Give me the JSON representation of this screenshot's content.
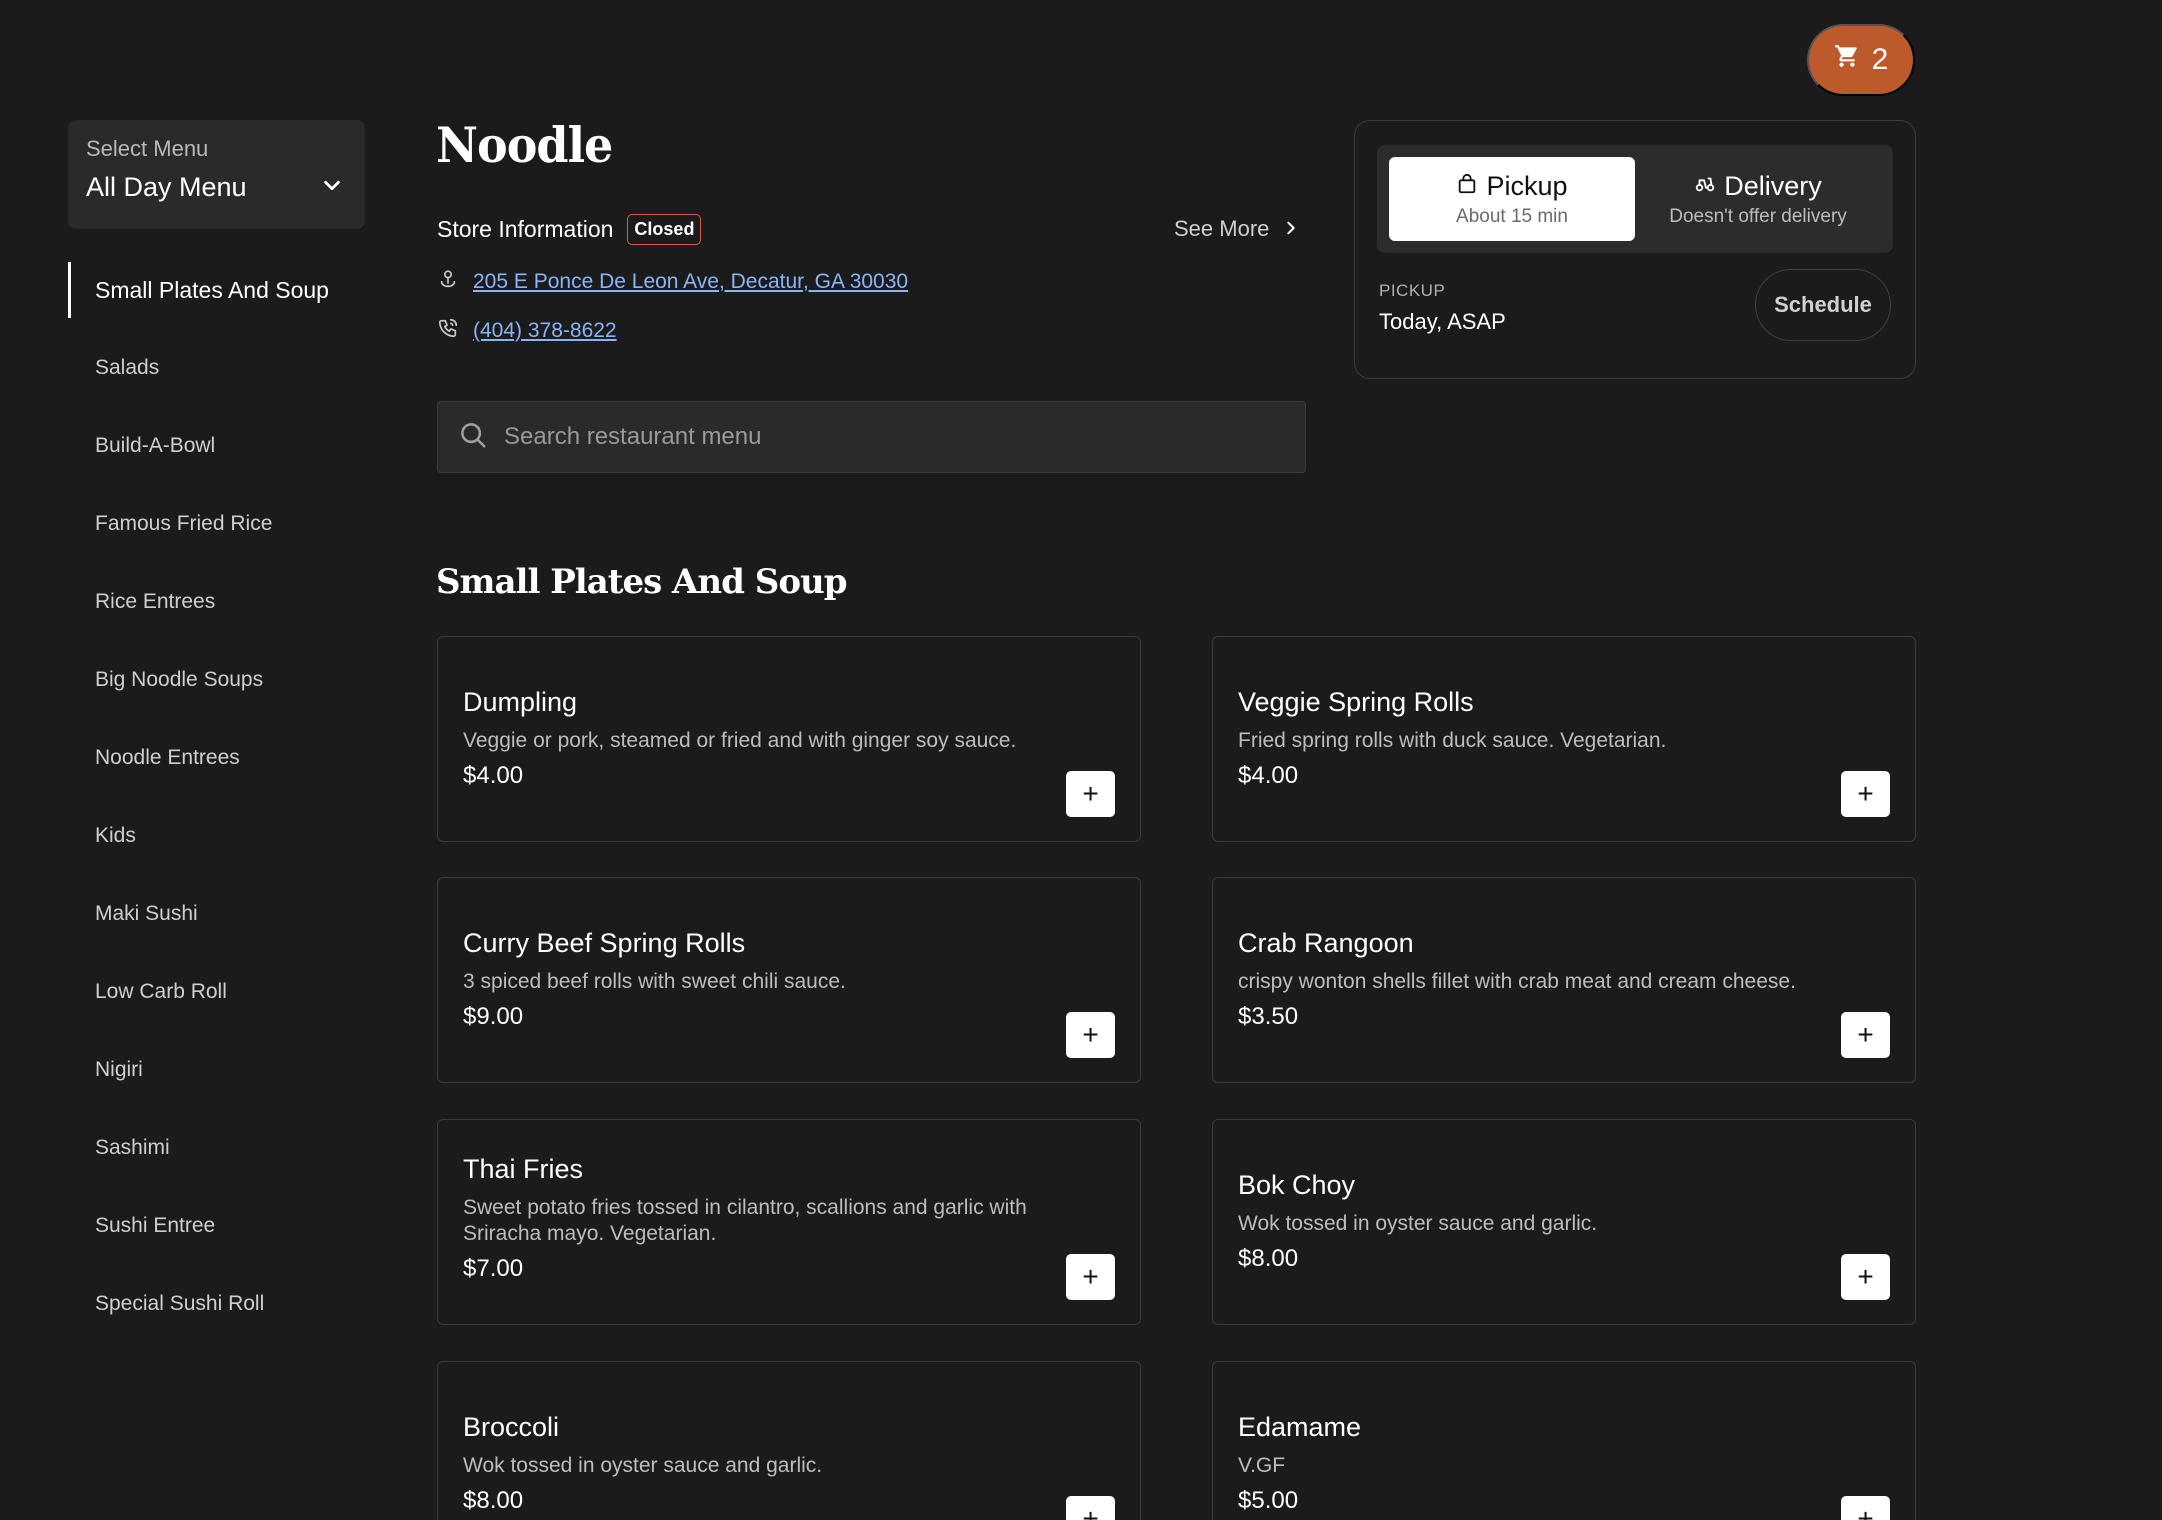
{
  "cart": {
    "count": "2",
    "icon": "cart-icon"
  },
  "menu_select": {
    "label": "Select Menu",
    "value": "All Day Menu"
  },
  "categories": [
    "Small Plates And Soup",
    "Salads",
    "Build-A-Bowl",
    "Famous Fried Rice",
    "Rice Entrees",
    "Big Noodle Soups",
    "Noodle Entrees",
    "Kids",
    "Maki Sushi",
    "Low Carb Roll",
    "Nigiri",
    "Sashimi",
    "Sushi Entree",
    "Special Sushi Roll"
  ],
  "store": {
    "title": "Noodle",
    "info_label": "Store Information",
    "status": "Closed",
    "see_more": "See More",
    "address": "205 E Ponce De Leon Ave, Decatur, GA 30030",
    "phone": "(404) 378-8622"
  },
  "search": {
    "placeholder": "Search restaurant menu"
  },
  "order": {
    "pickup_label": "Pickup",
    "pickup_sub": "About 15 min",
    "delivery_label": "Delivery",
    "delivery_sub": "Doesn't offer delivery",
    "mode_label": "PICKUP",
    "mode_value": "Today, ASAP",
    "schedule": "Schedule"
  },
  "section": {
    "title": "Small Plates And Soup"
  },
  "items": [
    {
      "name": "Dumpling",
      "desc": "Veggie or pork, steamed or fried and with ginger soy sauce.",
      "price": "$4.00"
    },
    {
      "name": "Veggie Spring Rolls",
      "desc": "Fried spring rolls with duck sauce. Vegetarian.",
      "price": "$4.00"
    },
    {
      "name": "Curry Beef Spring Rolls",
      "desc": "3 spiced beef rolls with sweet chili sauce.",
      "price": "$9.00"
    },
    {
      "name": "Crab Rangoon",
      "desc": "crispy wonton shells fillet with crab meat and cream cheese.",
      "price": "$3.50"
    },
    {
      "name": "Thai Fries",
      "desc": "Sweet potato fries tossed in cilantro, scallions and garlic with Sriracha mayo. Vegetarian.",
      "price": "$7.00"
    },
    {
      "name": "Bok Choy",
      "desc": "Wok tossed in oyster sauce and garlic.",
      "price": "$8.00"
    },
    {
      "name": "Broccoli",
      "desc": "Wok tossed in oyster sauce and garlic.",
      "price": "$8.00"
    },
    {
      "name": "Edamame",
      "desc": "V.GF",
      "price": "$5.00"
    }
  ],
  "add_label": "+"
}
